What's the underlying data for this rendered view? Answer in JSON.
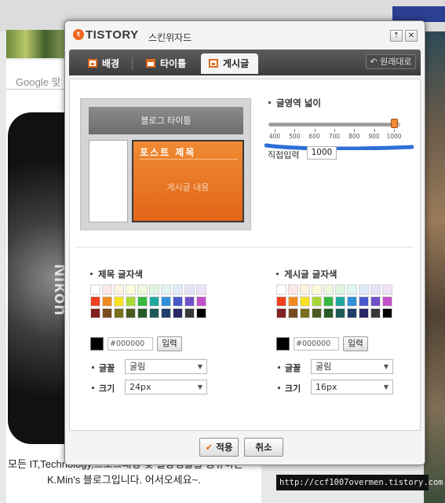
{
  "background": {
    "search_placeholder": "Google 맞",
    "photo_text": "Nikon",
    "caption_line1": "모든 IT,Technology,프로그래밍 및 일상생활을 공유하는",
    "caption_line2": "K.Min's 블로그입니다. 어서오세요~.",
    "watermark_url": "http://ccf1007overmen.tistory.com"
  },
  "dialog": {
    "logo_text": "TISTORY",
    "title": "스킨위자드",
    "pin_symbol": "⇡",
    "close_symbol": "✕"
  },
  "tabs": [
    {
      "label": "배경",
      "active": false
    },
    {
      "label": "타이틀",
      "active": false
    },
    {
      "label": "게시글",
      "active": true
    }
  ],
  "reset_label": "원래대로",
  "preview": {
    "blog_title": "블로그 타이틀",
    "post_title": "포스트 제목",
    "post_body": "게시글 내용"
  },
  "width": {
    "label": "글영역 넓이",
    "ticks": [
      "400",
      "500",
      "600",
      "700",
      "800",
      "900",
      "1000"
    ],
    "min": 400,
    "max": 1000,
    "value": 1000,
    "direct_label": "직접입력",
    "direct_value": "1000"
  },
  "palette_colors": [
    "#ffffff",
    "#fde8e8",
    "#fdf3de",
    "#fdfbd8",
    "#eef8dc",
    "#def5e2",
    "#def5f3",
    "#e0eaf8",
    "#e4e4f8",
    "#f0e2f8",
    "#f04020",
    "#f08a20",
    "#f8e020",
    "#a8d838",
    "#38b840",
    "#20a8a0",
    "#3090d8",
    "#4858c8",
    "#7050c8",
    "#c050c8",
    "#802020",
    "#7a4a20",
    "#787020",
    "#4a5a20",
    "#285a28",
    "#205a58",
    "#203e6a",
    "#282868",
    "#383838",
    "#000000"
  ],
  "title_color": {
    "label": "제목 글자색",
    "hex": "#000000",
    "apply_label": "입력",
    "font_label": "글꼴",
    "font_value": "굴림",
    "size_label": "크기",
    "size_value": "24px"
  },
  "body_color": {
    "label": "게시글 글자색",
    "hex": "#000000",
    "apply_label": "입력",
    "font_label": "글꼴",
    "font_value": "굴림",
    "size_label": "크기",
    "size_value": "16px"
  },
  "footer": {
    "apply_label": "적용",
    "cancel_label": "취소"
  },
  "colors": {
    "accent": "#e06a1c",
    "annotation_scribble": "#2f6fd6"
  }
}
